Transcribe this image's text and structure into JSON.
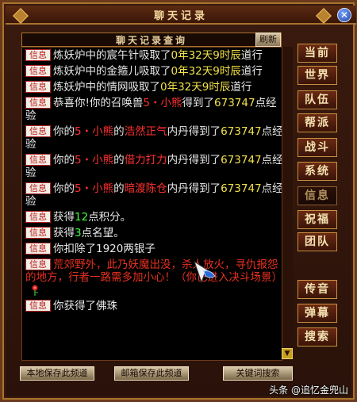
{
  "window": {
    "title": "聊天记录"
  },
  "panel": {
    "subtitle": "聊天记录查询",
    "refresh_label": "刷新"
  },
  "tag_label": "信息",
  "messages": [
    {
      "type": "plain",
      "pre": "炼妖炉中的宸午针吸取了",
      "hl": "0年32天9时辰",
      "post": "道行",
      "hl_color": "yellow"
    },
    {
      "type": "plain",
      "pre": "炼妖炉中的金箍儿吸取了",
      "hl": "0年32天9时辰",
      "post": "道行",
      "hl_color": "yellow"
    },
    {
      "type": "plain",
      "pre": "炼妖炉中的情网吸取了",
      "hl": "0年32天9时辰",
      "post": "道行",
      "hl_color": "yellow"
    },
    {
      "type": "pet",
      "pre": "恭喜你!你的召唤兽",
      "name": "5・小熊",
      "mid": "得到了",
      "num": "673747",
      "post": "点经验"
    },
    {
      "type": "skill",
      "pre": "你的",
      "name": "5・小熊",
      "de": "的",
      "skill": "浩然正气",
      "mid": "内丹得到了",
      "num": "673747",
      "post": "点经验"
    },
    {
      "type": "skill",
      "pre": "你的",
      "name": "5・小熊",
      "de": "的",
      "skill": "借力打力",
      "mid": "内丹得到了",
      "num": "673747",
      "post": "点经验"
    },
    {
      "type": "skill",
      "pre": "你的",
      "name": "5・小熊",
      "de": "的",
      "skill": "暗渡陈仓",
      "mid": "内丹得到了",
      "num": "673747",
      "post": "点经验"
    },
    {
      "type": "plain",
      "pre": "获得",
      "hl": "12",
      "post": "点积分。",
      "hl_color": "green"
    },
    {
      "type": "plain",
      "pre": "获得",
      "hl": "3",
      "post": "点名望。",
      "hl_color": "green"
    },
    {
      "type": "plain",
      "pre": "你扣除了1920两银子",
      "hl": "",
      "post": "",
      "hl_color": "none"
    },
    {
      "type": "warning",
      "text": "荒郊野外，此乃妖魔出没，杀人放火，寻仇报怨的地方，行者一路需多加小心！（你已进入决斗场景）"
    },
    {
      "type": "plain",
      "pre": "你获得了佛珠",
      "hl": "",
      "post": "",
      "hl_color": "none"
    }
  ],
  "side_nav": [
    {
      "label": "当前",
      "active": false
    },
    {
      "label": "世界",
      "active": false
    },
    {
      "label": "队伍",
      "active": false
    },
    {
      "label": "帮派",
      "active": false
    },
    {
      "label": "战斗",
      "active": false
    },
    {
      "label": "系统",
      "active": false
    },
    {
      "label": "信息",
      "active": true
    },
    {
      "label": "祝福",
      "active": false
    },
    {
      "label": "团队",
      "active": false
    },
    {
      "label": "传音",
      "active": false
    },
    {
      "label": "弹幕",
      "active": false
    },
    {
      "label": "搜索",
      "active": false
    }
  ],
  "bottom_bar": {
    "save_local": "本地保存此频道",
    "save_mail": "邮箱保存此频道",
    "keyword_search": "关键词搜索"
  },
  "watermark": "头条 @追忆金兜山",
  "colors": {
    "tag_red": "#c01818",
    "yellow": "#f2e24a",
    "red": "#ff3030",
    "green": "#40ff40",
    "gold_border": "#a8742e"
  },
  "icons": {
    "close": "close-icon",
    "scroll_down": "chevron-down-icon",
    "flower": "flower-icon",
    "cursor": "pointer-cursor-icon"
  }
}
